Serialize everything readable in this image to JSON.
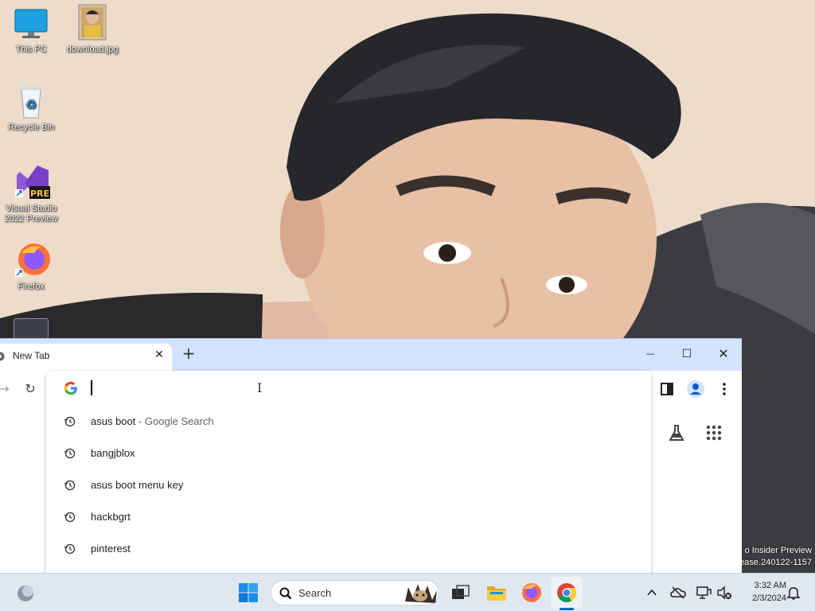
{
  "desktop": {
    "icons": [
      {
        "label": "This PC"
      },
      {
        "label": "download.jpg"
      },
      {
        "label": "Recycle Bin"
      },
      {
        "label": "Visual Studio 2022 Preview"
      },
      {
        "label": "Firefox"
      }
    ],
    "watermark_line1": "o Insider Preview",
    "watermark_line2": "ease.240122-1157"
  },
  "chrome": {
    "tab_title": "New Tab",
    "tab_close": "✕",
    "new_tab": "+",
    "minimize": "—",
    "maximize": "☐",
    "close": "✕",
    "back": "→",
    "reload": "↻",
    "omnibox_value": "",
    "suggestions": [
      {
        "text": "asus boot",
        "desc": " - Google Search"
      },
      {
        "text": "bangjblox",
        "desc": ""
      },
      {
        "text": "asus boot menu key",
        "desc": ""
      },
      {
        "text": "hackbgrt",
        "desc": ""
      },
      {
        "text": "pinterest",
        "desc": ""
      }
    ]
  },
  "taskbar": {
    "search_label": "Search",
    "time": "3:32 AM",
    "date": "2/3/2024"
  },
  "colors": {
    "tabstrip": "#d3e3fd",
    "accent": "#0067c0",
    "taskbar": "#dfe7f0"
  }
}
